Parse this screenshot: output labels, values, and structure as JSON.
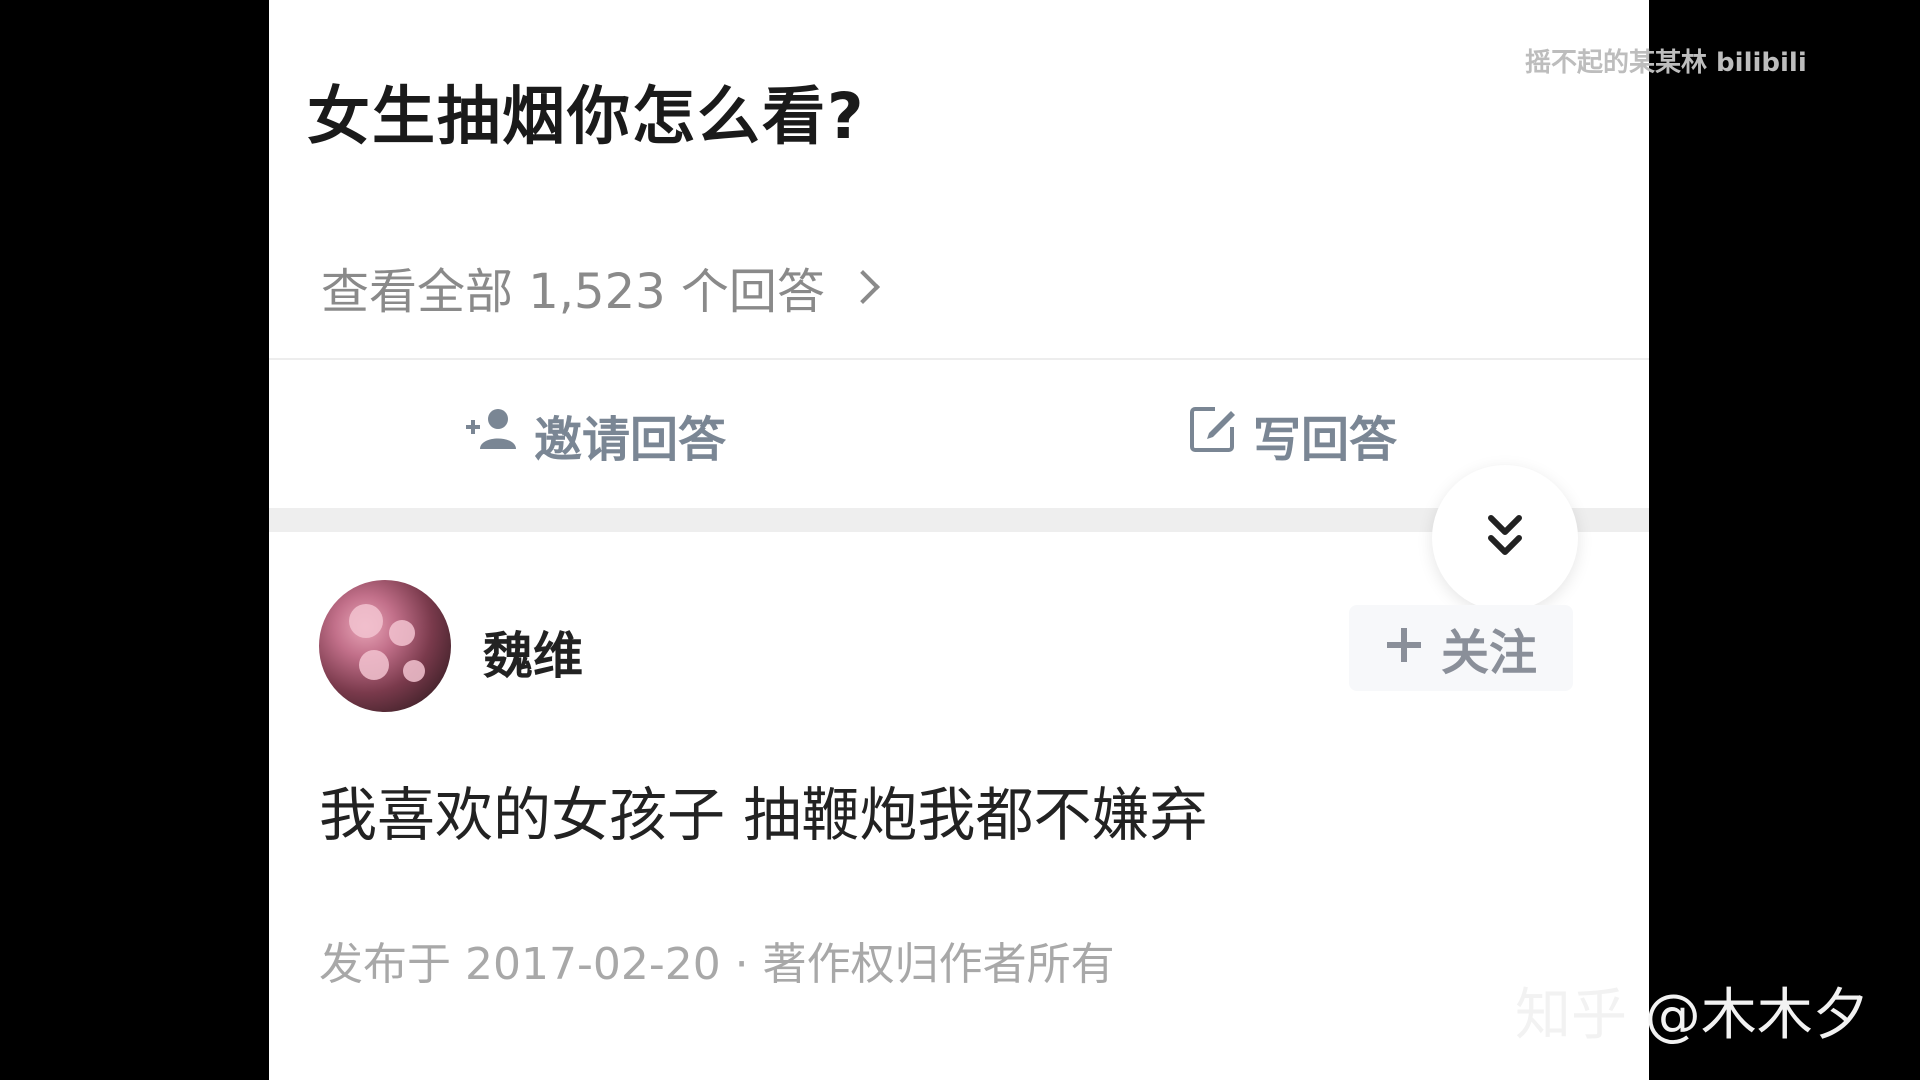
{
  "question": {
    "title": "女生抽烟你怎么看?",
    "view_all": "查看全部 1,523 个回答"
  },
  "actions": {
    "invite_label": "邀请回答",
    "invite_icon": "invite-person-icon",
    "write_label": "写回答",
    "write_icon": "edit-icon"
  },
  "expand_icon": "double-chevron-down-icon",
  "answer": {
    "author": "魏维",
    "follow_label": "关注",
    "text": "我喜欢的女孩子 抽鞭炮我都不嫌弃",
    "meta": "发布于 2017-02-20 · 著作权归作者所有"
  },
  "watermarks": {
    "top_right": "摇不起的某某林 bilibili",
    "bottom_right": "知乎 @木木夕"
  },
  "colors": {
    "background": "#000000",
    "panel": "#ffffff",
    "title": "#1a1a1a",
    "muted": "#8a8a8a",
    "action": "#7a8694"
  }
}
